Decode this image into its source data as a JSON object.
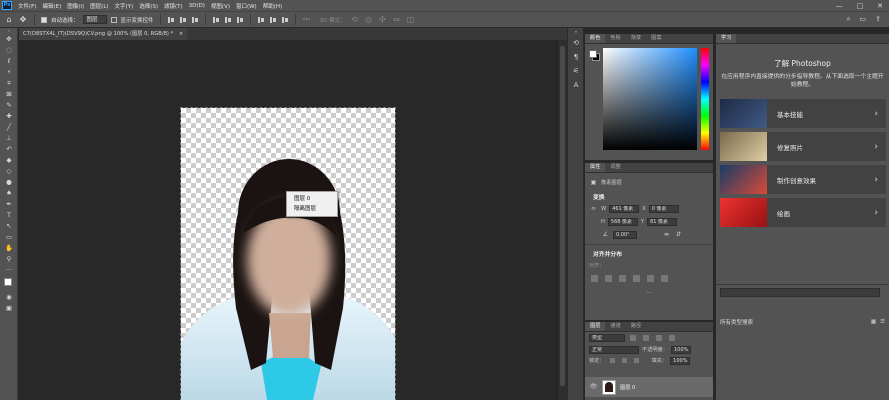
{
  "app": {
    "logo": "Ps"
  },
  "menubar": {
    "items": [
      "文件(F)",
      "编辑(E)",
      "图像(I)",
      "图层(L)",
      "文字(Y)",
      "选择(S)",
      "滤镜(T)",
      "3D(D)",
      "视图(V)",
      "窗口(W)",
      "帮助(H)"
    ],
    "window_controls": [
      "—",
      "□",
      "✕"
    ]
  },
  "optionsbar": {
    "auto_select_label": "自动选择：",
    "auto_select_value": "图层",
    "show_transform_label": "显示变换控件",
    "mode_3d_label": "3D 模式："
  },
  "document": {
    "tab_title": "C7(D8STX4L_IT)(DSV9Q)CV.png @ 100% (图层 0, RGB/8) *",
    "tab_close": "×"
  },
  "context_menu": {
    "items": [
      "图层 0",
      "隔离图层"
    ]
  },
  "color_panel": {
    "tabs": [
      "颜色",
      "色板",
      "渐变",
      "图案"
    ]
  },
  "properties_panel": {
    "tabs": [
      "属性",
      "调整"
    ],
    "pixel_layer_label": "像素图层",
    "transform_heading": "变换",
    "w_label": "W",
    "w_value": "461 像素",
    "x_label": "X",
    "x_value": "0 像素",
    "h_label": "H",
    "h_value": "568 像素",
    "y_label": "Y",
    "y_value": "81 像素",
    "angle_value": "0.00°",
    "align_heading": "对齐并分布",
    "align_label": "对齐：",
    "more": "..."
  },
  "layers_panel": {
    "tabs": [
      "图层",
      "通道",
      "路径"
    ],
    "filter_value": "类型",
    "blend_mode": "正常",
    "opacity_label": "不透明度：",
    "opacity_value": "100%",
    "lock_label": "锁定：",
    "fill_label": "填充：",
    "fill_value": "100%",
    "layer_name": "图层 0"
  },
  "learn_panel": {
    "tab": "学习",
    "title": "了解 Photoshop",
    "description": "在应用程序内直接提供的分步指导教程。从下面选取一个主题开始教程。",
    "cards": [
      {
        "label": "基本技能",
        "color": "#2b3a55"
      },
      {
        "label": "修复照片",
        "color": "#b9a27a"
      },
      {
        "label": "制作创意效果",
        "color": "#2f5e8e"
      },
      {
        "label": "绘画",
        "color": "#c4302b"
      }
    ],
    "library_filter": "所有类型搜索"
  }
}
